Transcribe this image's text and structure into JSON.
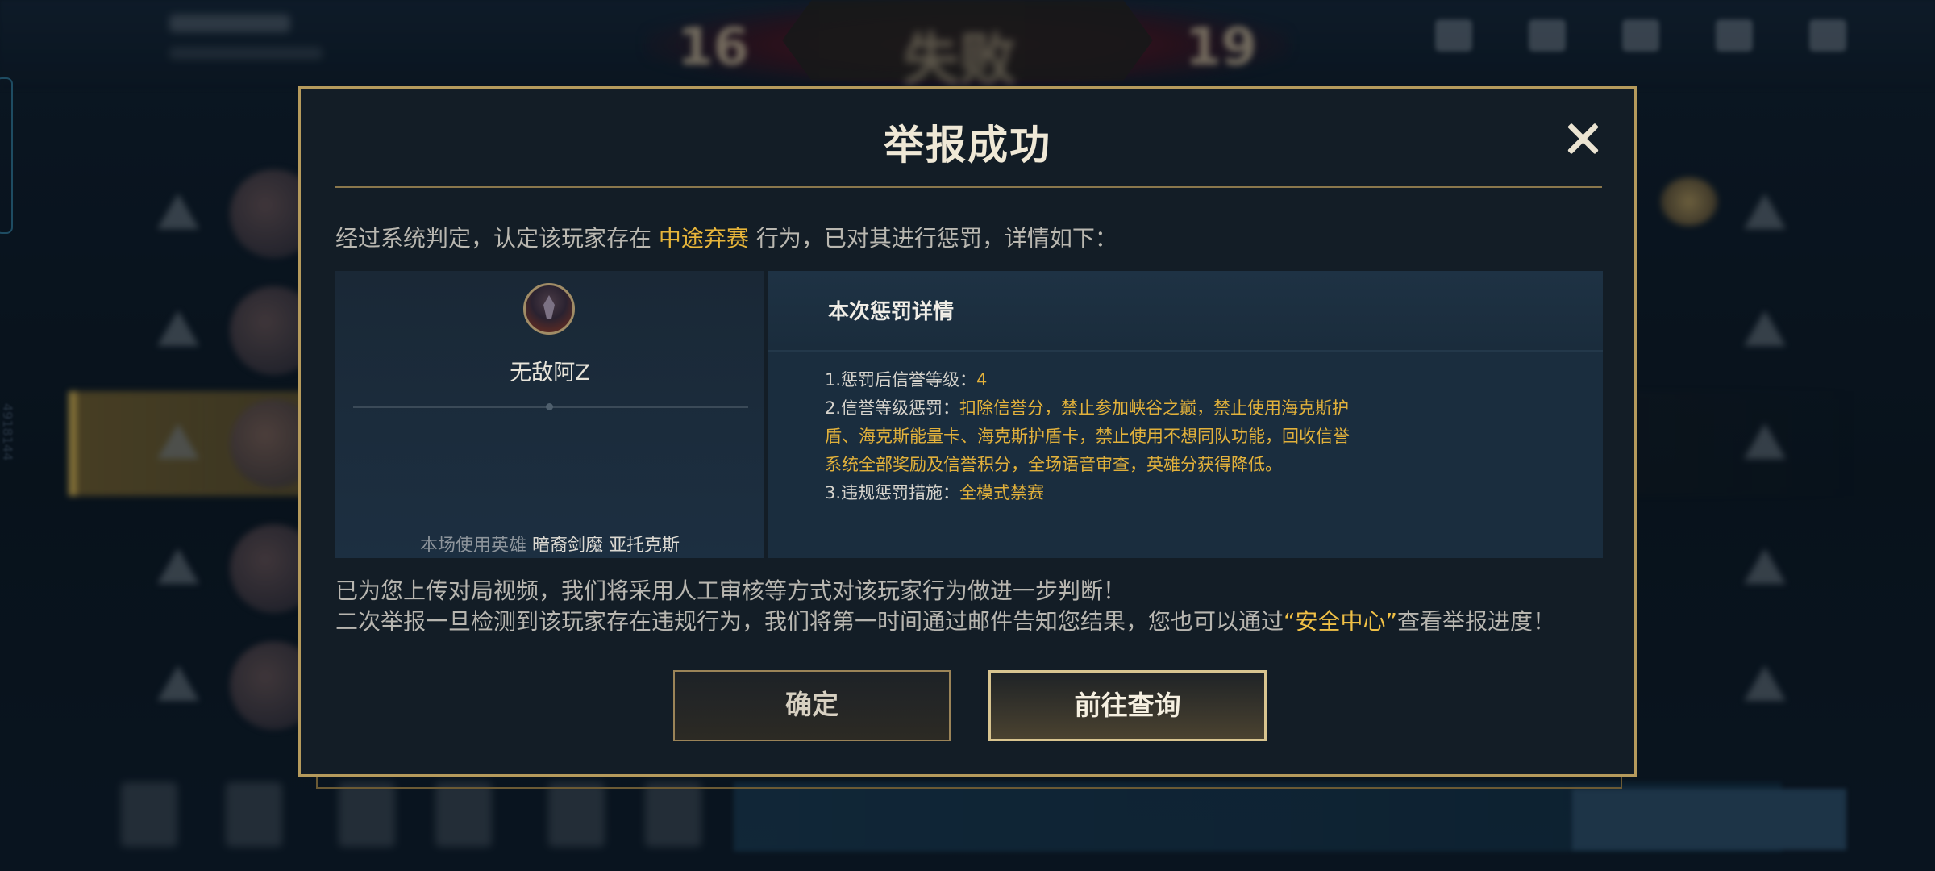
{
  "background": {
    "score_left": "16",
    "score_right": "19",
    "result": "失败",
    "side_id": "4918144"
  },
  "dialog": {
    "title": "举报成功",
    "intro_prefix": "经过系统判定，认定该玩家存在",
    "behavior": "中途弃赛",
    "intro_suffix": "行为，已对其进行惩罚，详情如下：",
    "player": {
      "name": "无敌阿Z",
      "hero_label": "本场使用英雄",
      "hero_name": "暗裔剑魔 亚托克斯"
    },
    "penalty": {
      "title": "本次惩罚详情",
      "item1_label": "1.惩罚后信誉等级：",
      "item1_value": "4",
      "item2_label": "2.信誉等级惩罚：",
      "item2_value_line1": "扣除信誉分，禁止参加峡谷之巅，禁止使用海克斯护",
      "item2_value_line2": "盾、海克斯能量卡、海克斯护盾卡，禁止使用不想同队功能，回收信誉",
      "item2_value_line3": "系统全部奖励及信誉积分，全场语音审查，英雄分获得降低。",
      "item3_label": "3.违规惩罚措施：",
      "item3_value": "全模式禁赛"
    },
    "notice_line1": "已为您上传对局视频，我们将采用人工审核等方式对该玩家行为做进一步判断！",
    "notice_line2_prefix": "二次举报一旦检测到该玩家存在违规行为，我们将第一时间通过邮件告知您结果，您也可以通过",
    "notice_link": "“安全中心”",
    "notice_line2_suffix": "查看举报进度！",
    "confirm_button": "确定",
    "query_button": "前往查询"
  },
  "colors": {
    "accent_gold": "#e7b53a",
    "border_gold": "#b59a5c",
    "dialog_bg": "#131d26"
  }
}
